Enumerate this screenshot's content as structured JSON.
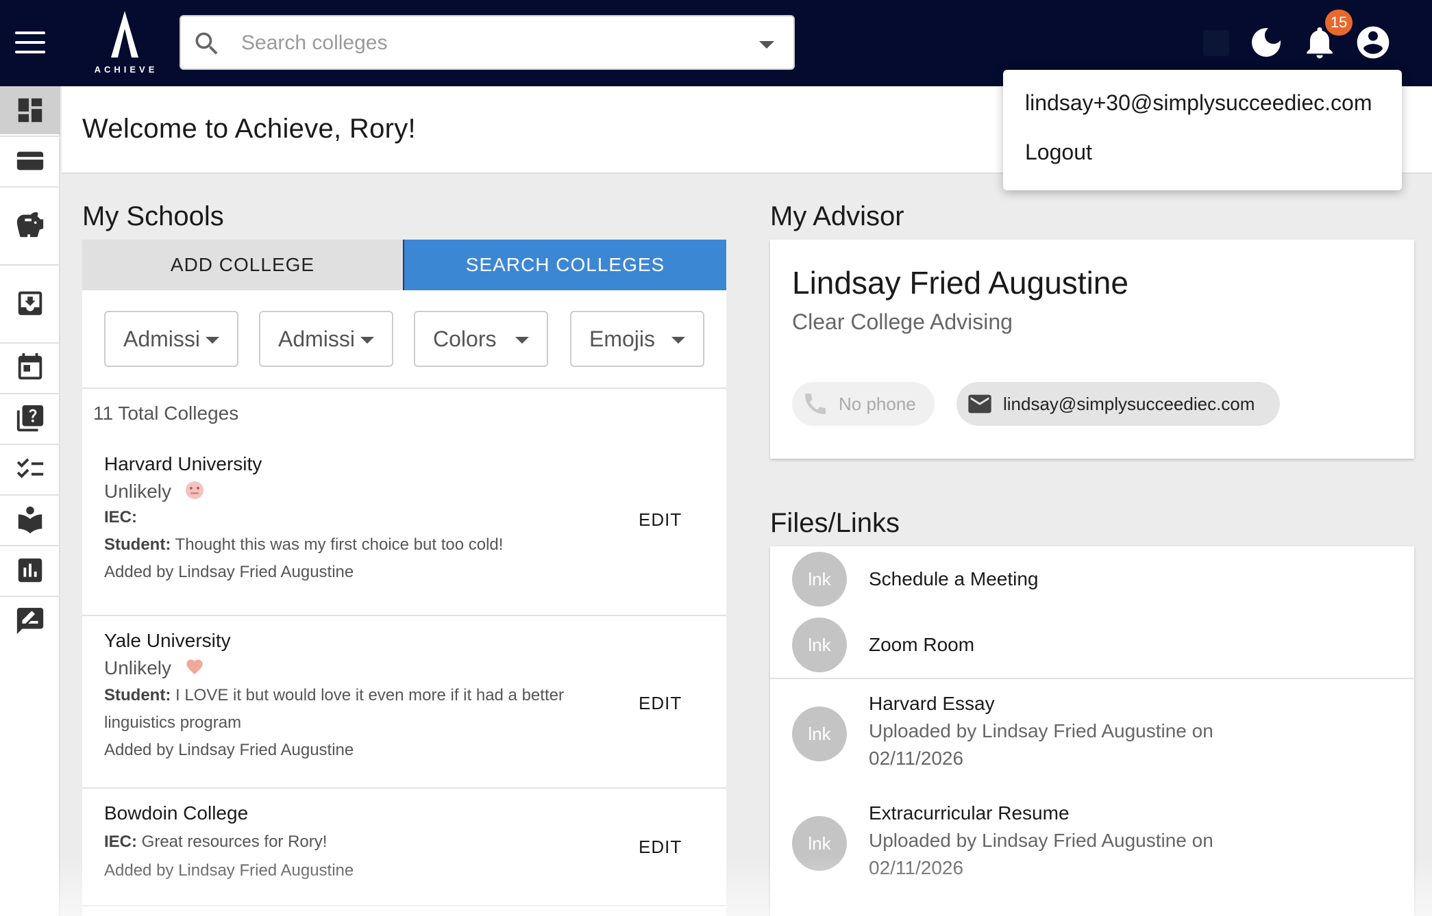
{
  "app": {
    "logo_text": "ACHIEVE",
    "notification_count": "15",
    "search": {
      "placeholder": "Search colleges"
    }
  },
  "user_menu": {
    "email": "lindsay+30@simplysucceediec.com",
    "logout": "Logout"
  },
  "sidebar": {
    "items": [
      {
        "icon": "dashboard-icon",
        "active": true
      },
      {
        "icon": "wallet-icon"
      },
      {
        "icon": "piggy-bank-icon"
      },
      {
        "icon": "inbox-icon"
      },
      {
        "icon": "calendar-icon"
      },
      {
        "icon": "question-library-icon"
      },
      {
        "icon": "checklist-icon"
      },
      {
        "icon": "reader-icon"
      },
      {
        "icon": "bar-chart-icon"
      },
      {
        "icon": "rate-review-icon"
      }
    ]
  },
  "welcome": {
    "title": "Welcome to Achieve, Rory!"
  },
  "schools": {
    "title": "My Schools",
    "add_label": "ADD COLLEGE",
    "search_label": "SEARCH COLLEGES",
    "filters": [
      "Admissi...",
      "Admissi...",
      "Colors",
      "Emojis"
    ],
    "filter_labels": {
      "f1": "Admissi",
      "f2": "Admissi",
      "f3": "Colors",
      "f4": "Emojis"
    },
    "total": "11 Total Colleges",
    "edit_label": "EDIT",
    "colleges": [
      {
        "name": "Harvard University",
        "status": "Unlikely",
        "emoji": "cold-face",
        "iec_label": "IEC:",
        "iec_text": "",
        "student_label": "Student:",
        "student_text": " Thought this was my first choice but too cold!",
        "added_by": "Added by Lindsay Fried Augustine"
      },
      {
        "name": "Yale University",
        "status": "Unlikely",
        "emoji": "heart",
        "student_label": "Student:",
        "student_text": " I LOVE it but would love it even more if it had a better linguistics program",
        "added_by": "Added by Lindsay Fried Augustine"
      },
      {
        "name": "Bowdoin College",
        "iec_label": "IEC:",
        "iec_text": " Great resources for Rory!",
        "added_by": "Added by Lindsay Fried Augustine"
      }
    ]
  },
  "advisor": {
    "title": "My Advisor",
    "name": "Lindsay Fried Augustine",
    "org": "Clear College Advising",
    "phone": "No phone",
    "email": "lindsay@simplysucceediec.com"
  },
  "files": {
    "title": "Files/Links",
    "avatar_text": "lnk",
    "items": [
      {
        "title": "Schedule a Meeting"
      },
      {
        "title": "Zoom Room"
      },
      {
        "title": "Harvard Essay",
        "subtitle": "Uploaded by Lindsay Fried Augustine on 02/11/2026"
      },
      {
        "title": "Extracurricular Resume",
        "subtitle": "Uploaded by Lindsay Fried Augustine on 02/11/2026"
      }
    ]
  },
  "colors": {
    "topbar": "#050b2e",
    "accent": "#3c87d4",
    "badge": "#e8692c"
  }
}
